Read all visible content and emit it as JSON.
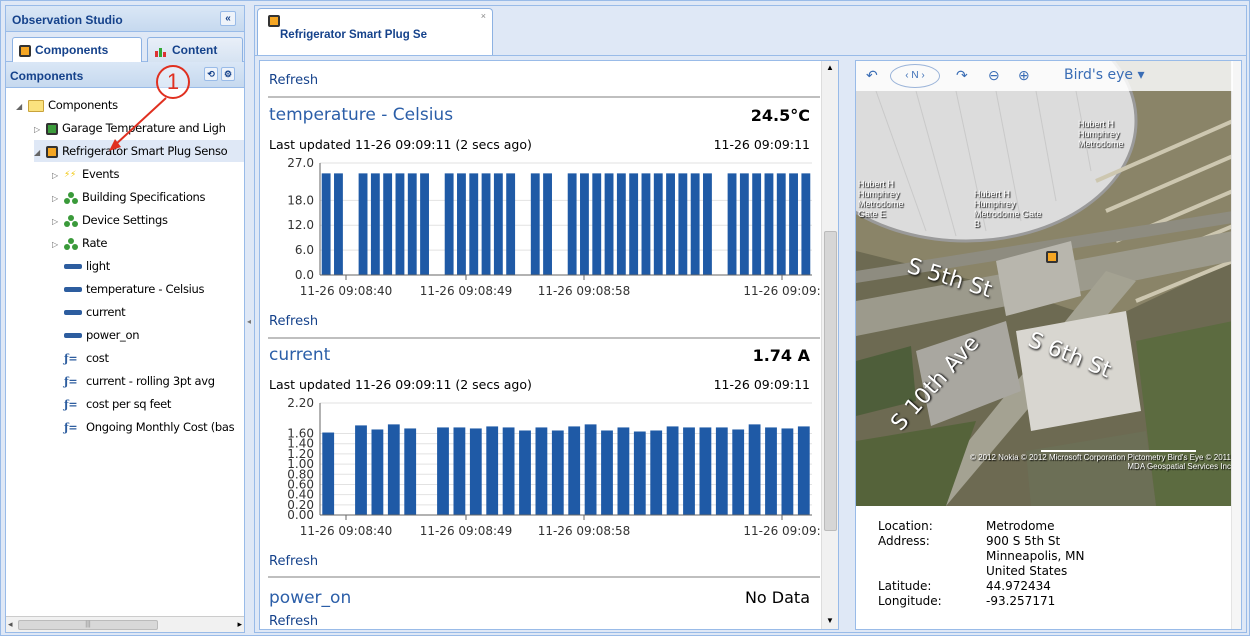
{
  "app": {
    "title": "Observation Studio"
  },
  "left_tabs": [
    {
      "label": "Components",
      "active": true
    },
    {
      "label": "Content",
      "active": false
    }
  ],
  "components_panel": {
    "title": "Components"
  },
  "annotation": {
    "number": "1"
  },
  "tree": [
    {
      "label": "Components",
      "icon": "folder-icon",
      "level": 0,
      "expanded": true
    },
    {
      "label": "Garage Temperature and Ligh",
      "icon": "device-icon",
      "level": 1,
      "expanded": false
    },
    {
      "label": "Refrigerator Smart Plug Senso",
      "icon": "device-icon",
      "level": 1,
      "expanded": true,
      "selected": true
    },
    {
      "label": "Events",
      "icon": "events-icon",
      "level": 2,
      "expanded": false
    },
    {
      "label": "Building Specifications",
      "icon": "group-icon",
      "level": 2,
      "expanded": false
    },
    {
      "label": "Device Settings",
      "icon": "group-icon",
      "level": 2,
      "expanded": false
    },
    {
      "label": "Rate",
      "icon": "group-icon",
      "level": 2,
      "expanded": false
    },
    {
      "label": "light",
      "icon": "datastream-icon",
      "level": 2
    },
    {
      "label": "temperature - Celsius",
      "icon": "datastream-icon",
      "level": 2
    },
    {
      "label": "current",
      "icon": "datastream-icon",
      "level": 2
    },
    {
      "label": "power_on",
      "icon": "datastream-icon",
      "level": 2
    },
    {
      "label": "cost",
      "icon": "function-icon",
      "level": 2
    },
    {
      "label": "current - rolling 3pt avg",
      "icon": "function-icon",
      "level": 2
    },
    {
      "label": "cost per sq feet",
      "icon": "function-icon",
      "level": 2
    },
    {
      "label": "Ongoing Monthly Cost (bas",
      "icon": "function-icon",
      "level": 2
    }
  ],
  "doc_tab": {
    "title": "Refrigerator Smart Plug Se"
  },
  "sections": {
    "refresh_label": "Refresh",
    "temperature": {
      "name": "temperature - Celsius",
      "value": "24.5°C",
      "updated": "Last updated 11-26 09:09:11 (2 secs ago)",
      "timestamp": "11-26 09:09:11"
    },
    "current": {
      "name": "current",
      "value": "1.74 A",
      "updated": "Last updated 11-26 09:09:11 (2 secs ago)",
      "timestamp": "11-26 09:09:11"
    },
    "power_on": {
      "name": "power_on",
      "value": "No Data"
    }
  },
  "chart_data": [
    {
      "type": "bar",
      "title": "",
      "ylim": [
        0,
        27
      ],
      "yticks": [
        "27.0",
        "18.0",
        "12.0",
        "6.0",
        "0.0"
      ],
      "ytick_values": [
        27,
        18,
        12,
        6,
        0
      ],
      "xticks": [
        "11-26 09:08:40",
        "11-26 09:08:49",
        "11-26 09:08:58",
        "11-26 09:09:"
      ],
      "values": [
        24.5,
        24.5,
        null,
        24.5,
        24.5,
        24.5,
        24.5,
        24.5,
        24.5,
        null,
        24.5,
        24.5,
        24.5,
        24.5,
        24.5,
        24.5,
        null,
        24.5,
        24.5,
        null,
        24.5,
        24.5,
        24.5,
        24.5,
        24.5,
        24.5,
        24.5,
        24.5,
        24.5,
        24.5,
        24.5,
        24.5,
        null,
        24.5,
        24.5,
        24.5,
        24.5,
        24.5,
        24.5,
        24.5
      ],
      "color": "#1f5aa6"
    },
    {
      "type": "bar",
      "title": "",
      "ylim": [
        0,
        2.2
      ],
      "yticks": [
        "2.20",
        "1.60",
        "1.40",
        "1.20",
        "1.00",
        "0.80",
        "0.60",
        "0.40",
        "0.20",
        "0.00"
      ],
      "ytick_values": [
        2.2,
        1.6,
        1.4,
        1.2,
        1.0,
        0.8,
        0.6,
        0.4,
        0.2,
        0.0
      ],
      "xticks": [
        "11-26 09:08:40",
        "11-26 09:08:49",
        "11-26 09:08:58",
        "11-26 09:09:"
      ],
      "values": [
        1.62,
        null,
        1.76,
        1.68,
        1.78,
        1.7,
        null,
        1.72,
        1.72,
        1.7,
        1.74,
        1.72,
        1.66,
        1.72,
        1.66,
        1.74,
        1.78,
        1.66,
        1.72,
        1.64,
        1.66,
        1.74,
        1.72,
        1.72,
        1.72,
        1.68,
        1.78,
        1.72,
        1.7,
        1.74
      ],
      "color": "#1f5aa6"
    }
  ],
  "map": {
    "view_label": "Bird's eye",
    "compass_label": "N",
    "streets": [
      "S 5th St",
      "S 6th St",
      "S 10th Ave"
    ],
    "place_labels": [
      "Hubert H Humphrey Metrodome",
      "Hubert H Humphrey Metrodome Gate E",
      "Hubert H Humphrey Metrodome Gate B"
    ],
    "copyright": "© 2012 Nokia  © 2012 Microsoft Corporation  Pictometry Bird's Eye © 2011 MDA Geospatial Services Inc"
  },
  "location_info": {
    "location_label": "Location:",
    "location": "Metrodome",
    "address_label": "Address:",
    "address_line1": "900 S 5th St",
    "address_line2": "Minneapolis, MN",
    "address_line3": "United States",
    "latitude_label": "Latitude:",
    "latitude": "44.972434",
    "longitude_label": "Longitude:",
    "longitude": "-93.257171"
  }
}
